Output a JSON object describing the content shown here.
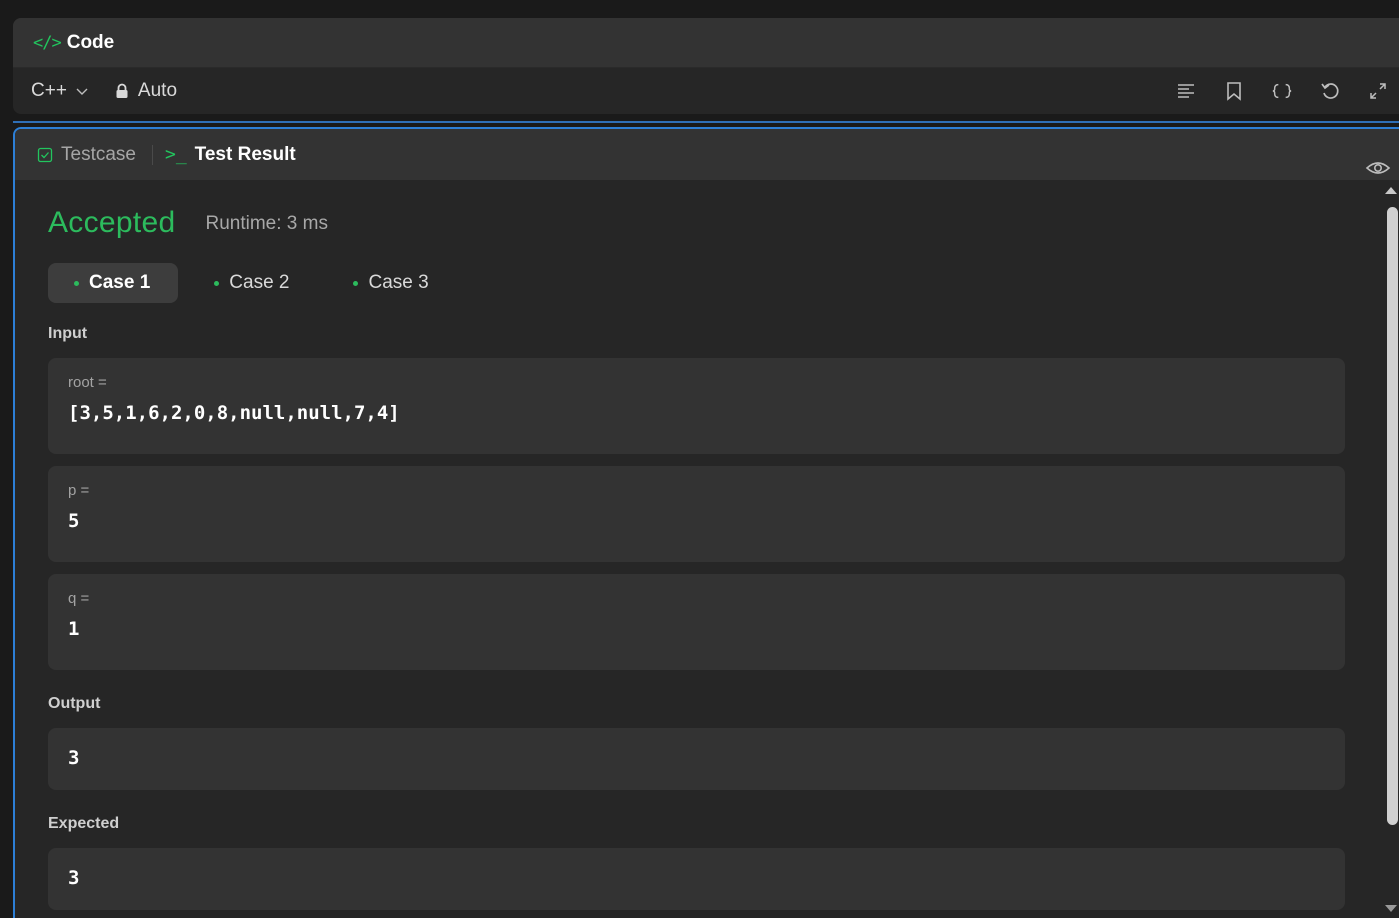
{
  "code_panel": {
    "title_glyph": "</>",
    "title": "Code",
    "language": "C++",
    "mode": "Auto",
    "toolbar_icons": [
      "format-icon",
      "bookmark-icon",
      "braces-icon",
      "reset-icon",
      "expand-icon"
    ]
  },
  "test_panel": {
    "tabs": {
      "testcase": "Testcase",
      "result_glyph": ">_",
      "result": "Test Result"
    },
    "status": "Accepted",
    "runtime": "Runtime: 3 ms",
    "cases": [
      "Case 1",
      "Case 2",
      "Case 3"
    ],
    "active_case": "Case 1",
    "input_label": "Input",
    "inputs": [
      {
        "name": "root =",
        "value": "[3,5,1,6,2,0,8,null,null,7,4]"
      },
      {
        "name": "p =",
        "value": "5"
      },
      {
        "name": "q =",
        "value": "1"
      }
    ],
    "output_label": "Output",
    "output_value": "3",
    "expected_label": "Expected",
    "expected_value": "3"
  },
  "colors": {
    "accent_green": "#2cbb5d",
    "focus_blue": "#2d7fd6",
    "panel_bg": "#262626",
    "box_bg": "#333333"
  }
}
